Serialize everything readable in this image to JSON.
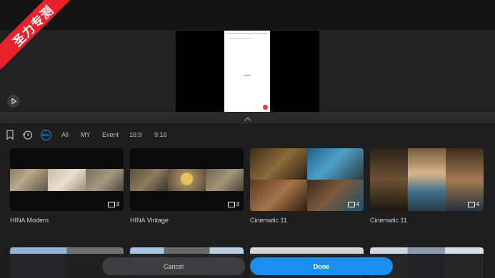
{
  "watermark": {
    "text": "圣力专测"
  },
  "filters": {
    "new_badge": "NEW",
    "chips": [
      "All",
      "MY",
      "Event",
      "16:9",
      "9:16"
    ]
  },
  "templates": [
    {
      "title": "HINA Modern",
      "count": "3"
    },
    {
      "title": "HINA Vintage",
      "count": "3"
    },
    {
      "title": "Cinematic 11",
      "count": "4"
    },
    {
      "title": "Cinematic 11",
      "count": "4"
    }
  ],
  "buttons": {
    "cancel": "Cancel",
    "done": "Done"
  },
  "colors": {
    "accent": "#1a8ff0",
    "watermark": "#e8232b"
  }
}
